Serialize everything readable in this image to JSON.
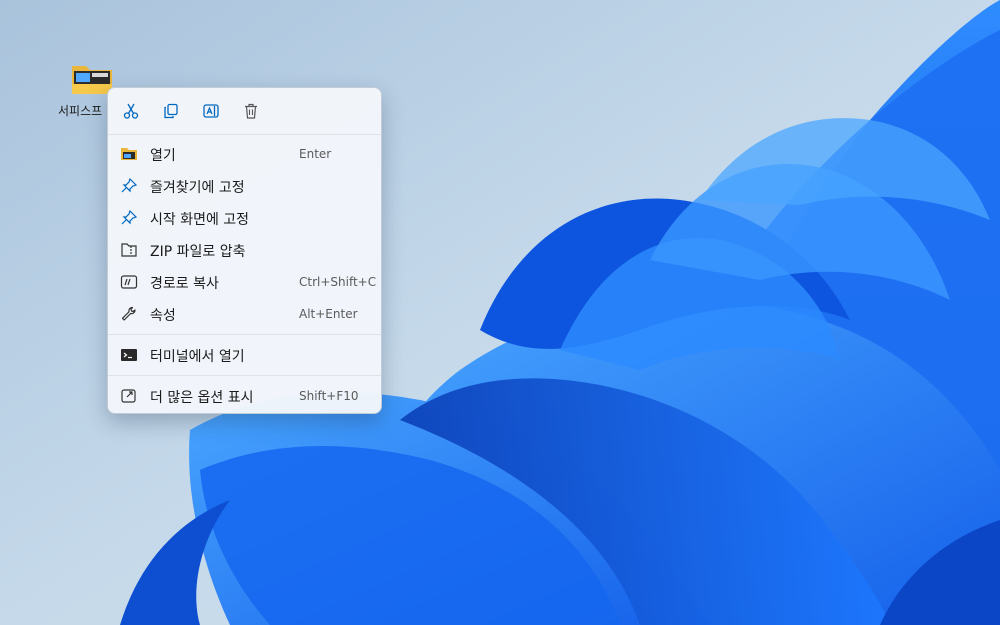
{
  "desktop": {
    "icon_label": "서피스프",
    "icon_name": "folder-icon"
  },
  "context_menu": {
    "toolbar": [
      {
        "name": "cut-icon"
      },
      {
        "name": "copy-icon"
      },
      {
        "name": "rename-icon"
      },
      {
        "name": "delete-icon"
      }
    ],
    "items": [
      {
        "label": "열기",
        "accel": "Enter",
        "icon": "folder-icon"
      },
      {
        "label": "즐겨찾기에 고정",
        "accel": "",
        "icon": "pin-icon"
      },
      {
        "label": "시작 화면에 고정",
        "accel": "",
        "icon": "pin-icon"
      },
      {
        "label": "ZIP 파일로 압축",
        "accel": "",
        "icon": "zip-icon"
      },
      {
        "label": "경로로 복사",
        "accel": "Ctrl+Shift+C",
        "icon": "copy-path-icon"
      },
      {
        "label": "속성",
        "accel": "Alt+Enter",
        "icon": "wrench-icon"
      },
      {
        "label": "터미널에서 열기",
        "accel": "",
        "icon": "terminal-icon"
      },
      {
        "label": "더 많은 옵션 표시",
        "accel": "Shift+F10",
        "icon": "open-external-icon"
      }
    ]
  },
  "colors": {
    "accent": "#0067c0",
    "wallpaper_blue": "#1a6ef5",
    "wallpaper_bg": "#bcd2e4"
  }
}
